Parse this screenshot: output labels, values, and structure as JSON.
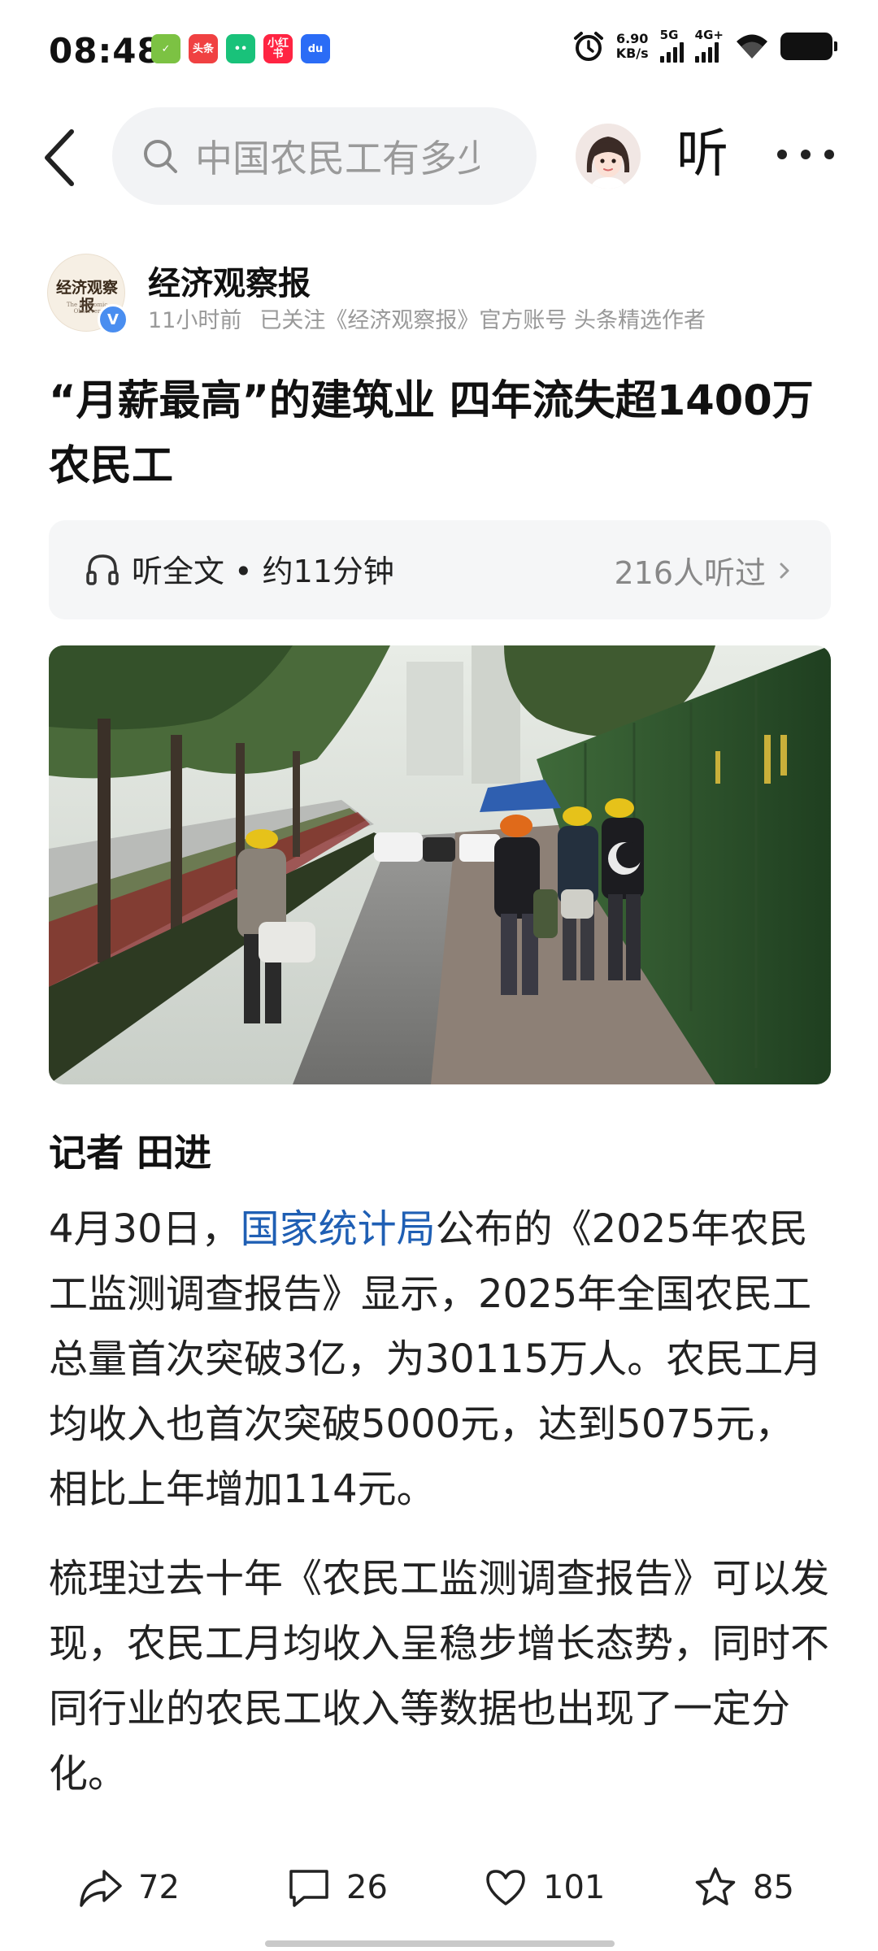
{
  "status_bar": {
    "time": "08:48",
    "app_badges": [
      {
        "label": "✓",
        "color": "#7cc243"
      },
      {
        "label": "头条",
        "color": "#f04142"
      },
      {
        "label": "••",
        "color": "#19c27a"
      },
      {
        "label": "小红书",
        "color": "#ff2442"
      },
      {
        "label": "du",
        "color": "#2b6cf6"
      }
    ],
    "net_speed_value": "6.90",
    "net_speed_unit": "KB/s",
    "net_type_1": "5G",
    "net_type_2": "4G+"
  },
  "top_nav": {
    "search_text": "中国农民工有多少",
    "listen_label": "听"
  },
  "author": {
    "logo_text": "经济观察报",
    "logo_subtext": "The Economic Observer",
    "name": "经济观察报",
    "time_ago": "11小时前",
    "follow_status": "已关注",
    "account_note": "《经济观察报》官方账号 头条精选作者"
  },
  "article": {
    "title": "“月薪最高”的建筑业 四年流失超1400万农民工",
    "listen_full_text": "听全文 • 约11分钟",
    "listen_count": "216人听过",
    "byline": "记者 田进",
    "para1_prefix": "4月30日，",
    "para1_link": "国家统计局",
    "para1_rest": "公布的《2025年农民工监测调查报告》显示，2025年全国农民工总量首次突破3亿，为30115万人。农民工月均收入也首次突破5000元，达到5075元，相比上年增加114元。",
    "para2": "梳理过去十年《农民工监测调查报告》可以发现，农民工月均收入呈稳步增长态势，同时不同行业的农民工收入等数据也出现了一定分化。"
  },
  "actions": {
    "share_count": "72",
    "comment_count": "26",
    "like_count": "101",
    "favorite_count": "85"
  }
}
